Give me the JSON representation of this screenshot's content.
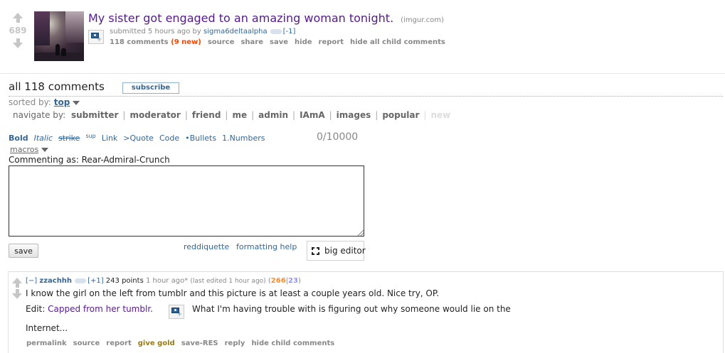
{
  "post": {
    "score": "689",
    "title": "My sister got engaged to an amazing woman tonight.",
    "domain": "(imgur.com)",
    "tagline": {
      "prefix": "submitted 5 hours ago by",
      "author": "sigma6deltaalpha",
      "vote_mod": "[-1]"
    },
    "buttons": {
      "comments": "118 comments",
      "new_count": "(9 new)",
      "source": "source",
      "share": "share",
      "save": "save",
      "hide": "hide",
      "report": "report",
      "hide_child": "hide all child comments"
    }
  },
  "comments_area": {
    "title": "all 118 comments",
    "subscribe": "subscribe",
    "sorted_label": "sorted by:",
    "sorted_value": "top",
    "navigate_label": "navigate by:",
    "navigate_items": [
      "submitter",
      "moderator",
      "friend",
      "me",
      "admin",
      "IAmA",
      "images",
      "popular",
      "new"
    ]
  },
  "editor": {
    "toolbar": {
      "bold": "Bold",
      "italic": "Italic",
      "strike": "strike",
      "sup": "sup",
      "link": "Link",
      "quote": ">Quote",
      "code": "Code",
      "bullets": "•Bullets",
      "numbers": "1.Numbers"
    },
    "char_count": "0/10000",
    "macros": "macros",
    "commenting_as": "Commenting as: Rear-Admiral-Crunch",
    "textarea_value": "",
    "save": "save",
    "reddiquette": "reddiquette",
    "formatting_help": "formatting help",
    "big_editor": "big editor"
  },
  "comment": {
    "expand": "[−]",
    "author": "zzachhh",
    "vote_mod": "[+1]",
    "points": "243 points",
    "time": "1 hour ago*",
    "edited": "(last edited 1 hour ago)",
    "ups": "266",
    "downs": "23",
    "line1": "I know the girl on the left from tumblr and this picture is at least a couple years old. Nice try, OP.",
    "edit_prefix": "Edit:",
    "edit_link": "Capped from her tumblr.",
    "edit_suffix": "What I'm having trouble with is figuring out why someone would lie on the",
    "line3": "Internet...",
    "buttons": {
      "permalink": "permalink",
      "source": "source",
      "report": "report",
      "give_gold": "give gold",
      "save_res": "save-RES",
      "reply": "reply",
      "hide_child": "hide child comments"
    }
  },
  "colors": {
    "link_blue": "#336699",
    "visited_purple": "#551a8b",
    "new_orange": "#ff4500",
    "ups_orange": "#ff8b24",
    "downs_blue": "#9494ff"
  }
}
